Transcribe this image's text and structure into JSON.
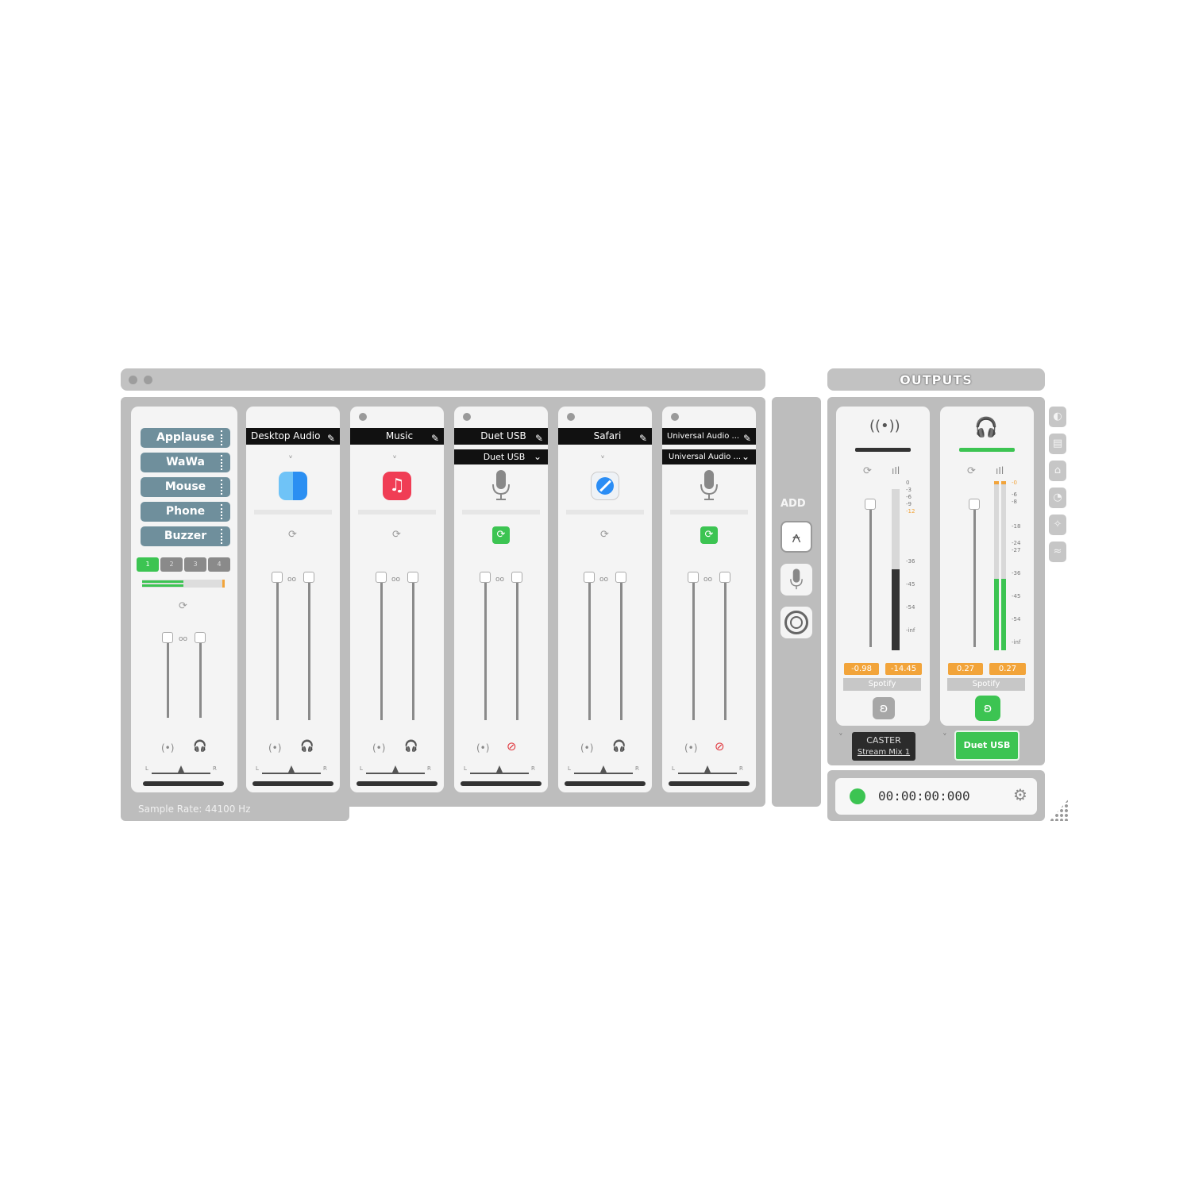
{
  "colors": {
    "panel": "#bdbdbd",
    "strip": "#f4f4f4",
    "accent_green": "#3cc452",
    "readout_orange": "#f2a43a",
    "sound_button": "#6f8f9c",
    "muted_red": "#e0383e"
  },
  "soundboard": {
    "buttons": [
      "Applause",
      "WaWa",
      "Mouse",
      "Phone",
      "Buzzer"
    ],
    "pages": [
      "1",
      "2",
      "3",
      "4"
    ],
    "active_page": "1"
  },
  "channels": [
    {
      "name": "Desktop Audio",
      "icon": "finder-icon",
      "balance_left": "L",
      "balance_right": "R"
    },
    {
      "name": "Music",
      "icon": "music-icon",
      "balance_left": "L",
      "balance_right": "R"
    },
    {
      "name": "Duet USB",
      "sub": "Duet USB",
      "icon": "microphone-icon",
      "balance_left": "L",
      "balance_right": "R"
    },
    {
      "name": "Safari",
      "icon": "safari-icon",
      "balance_left": "L",
      "balance_right": "R"
    },
    {
      "name": "Universal Audio ...",
      "sub": "Universal Audio ...",
      "icon": "microphone-icon",
      "balance_left": "L",
      "balance_right": "R"
    }
  ],
  "sample_rate": "Sample Rate: 44100 Hz",
  "add": {
    "label": "ADD"
  },
  "outputs": {
    "title": "OUTPUTS",
    "stream": {
      "scale": [
        "0",
        "-3",
        "-6",
        "-9",
        "-12",
        "-36",
        "-45",
        "-54",
        "-inf"
      ],
      "readout_left": "-0.98",
      "readout_right": "-14.45",
      "source": "Spotify",
      "device_line1": "CASTER",
      "device_line2": "Stream Mix 1"
    },
    "monitor": {
      "scale": [
        "-0",
        "-6",
        "-8",
        "-18",
        "-24",
        "-27",
        "-36",
        "-45",
        "-54",
        "-inf"
      ],
      "readout_left": "0.27",
      "readout_right": "0.27",
      "source": "Spotify",
      "device": "Duet USB"
    }
  },
  "recorder": {
    "time": "00:00:00:000"
  }
}
